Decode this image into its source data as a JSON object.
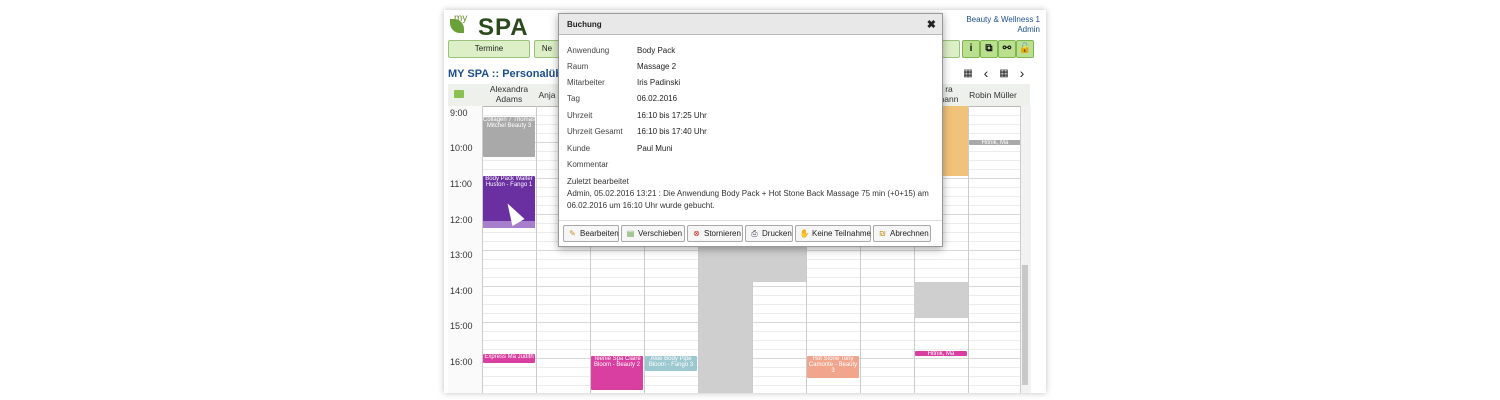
{
  "app": {
    "logo_my": "my",
    "logo_spa": "SPA",
    "company": "Beauty & Wellness 1",
    "user": "Admin",
    "page_title": "MY SPA :: Personalüber"
  },
  "nav": {
    "termine": "Termine",
    "second": "Ne"
  },
  "icons": {
    "info": "i",
    "copy": "⧉",
    "link": "⚯",
    "lock": "🔓",
    "calendar": "▦",
    "prev": "‹",
    "next": "›"
  },
  "columns": {
    "c1": [
      "Alexandra",
      "Adams"
    ],
    "c2": "Anja",
    "c9": [
      "ra",
      "hann"
    ],
    "c10": "Robin Müller"
  },
  "times": [
    "9:00",
    "10:00",
    "11:00",
    "12:00",
    "13:00",
    "14:00",
    "15:00",
    "16:00"
  ],
  "events": {
    "e1": "Collagen 7 Thomas Mitchel Beauty 3",
    "e2": "Body Pack Walter Huston - Fango 1",
    "e3": "Express Ma Judith",
    "e4": "Teenie Spa Claire Bloom - Beauty 2",
    "e5": "Aloe Body Pipe Bloom - Fango 3",
    "e6": "Hot Stone Tony Camonte - Beauty 3",
    "e7": "Hitnik, Ma",
    "e8": "Hitnik, Ma"
  },
  "modal": {
    "title": "Buchung",
    "close": "✖",
    "rows": [
      {
        "label": "Anwendung",
        "value": "Body Pack"
      },
      {
        "label": "Raum",
        "value": "Massage 2"
      },
      {
        "label": "Mitarbeiter",
        "value": "Iris Padinski"
      },
      {
        "label": "Tag",
        "value": "06.02.2016"
      },
      {
        "label": "Uhrzeit",
        "value": "16:10 bis 17:25 Uhr"
      },
      {
        "label": "Uhrzeit Gesamt",
        "value": "16:10 bis 17:40 Uhr"
      },
      {
        "label": "Kunde",
        "value": "Paul Muni"
      },
      {
        "label": "Kommentar",
        "value": ""
      }
    ],
    "edited_label": "Zuletzt bearbeitet",
    "edited_text": "Admin, 05.02.2016 13:21 : Die Anwendung Body Pack + Hot Stone Back Massage 75 min (+0+15) am 06.02.2016 um 16:10 Uhr wurde gebucht.",
    "buttons": {
      "edit": "Bearbeiten",
      "move": "Verschieben",
      "cancel": "Stornieren",
      "print": "Drucken",
      "noshow": "Keine Teilnahme",
      "bill": "Abrechnen"
    }
  }
}
